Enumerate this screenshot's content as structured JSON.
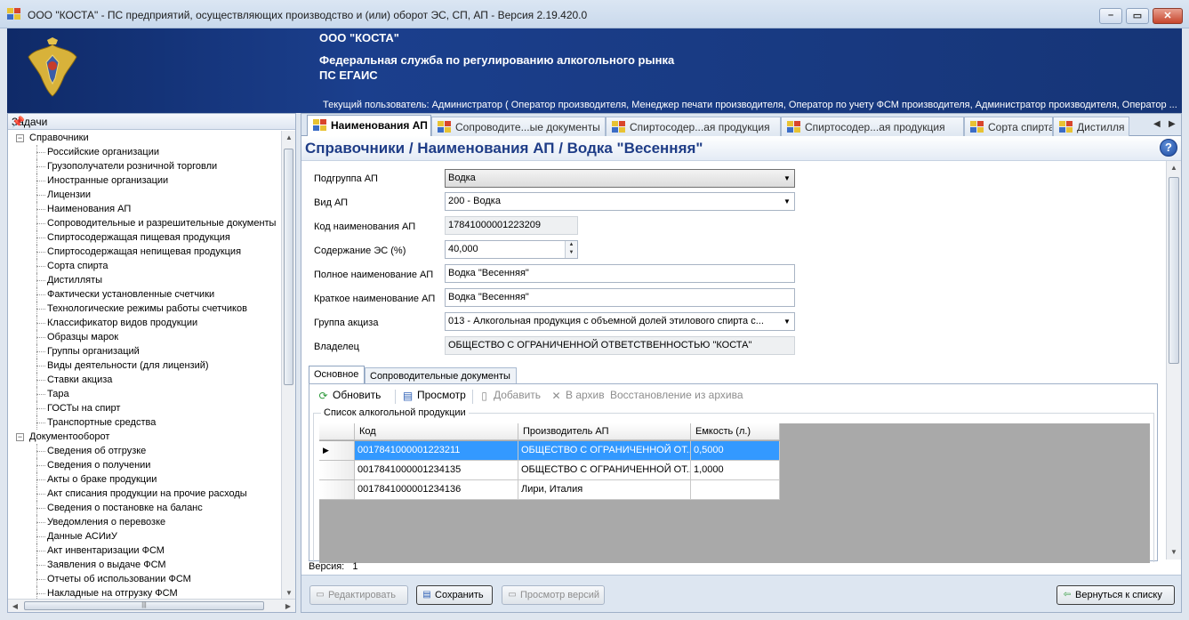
{
  "window": {
    "title": "ООО \"КОСТА\" - ПС предприятий, осуществляющих производство и (или) оборот ЭС, СП, АП - Версия 2.19.420.0"
  },
  "banner": {
    "org": "ООО \"КОСТА\"",
    "agency": "Федеральная служба по регулированию алкогольного рынка",
    "system": "ПС ЕГАИС",
    "current_user": "Текущий пользователь: Администратор ( Оператор производителя, Менеджер печати производителя, Оператор по учету ФСМ производителя, Администратор производителя, Оператор ..."
  },
  "tasks": {
    "header": "Задачи",
    "groups": [
      {
        "label": "Справочники",
        "items": [
          "Российские организации",
          "Грузополучатели розничной торговли",
          "Иностранные организации",
          "Лицензии",
          "Наименования АП",
          "Сопроводительные и разрешительные документы",
          "Спиртосодержащая пищевая продукция",
          "Спиртосодержащая непищевая продукция",
          "Сорта спирта",
          "Дистилляты",
          "Фактически установленные счетчики",
          "Технологические режимы работы счетчиков",
          "Классификатор видов продукции",
          "Образцы марок",
          "Группы организаций",
          "Виды деятельности (для лицензий)",
          "Ставки акциза",
          "Тара",
          "ГОСТы на спирт",
          "Транспортные средства"
        ]
      },
      {
        "label": "Документооборот",
        "items": [
          "Сведения об отгрузке",
          "Сведения о получении",
          "Акты о браке продукции",
          "Акт списания продукции на прочие расходы",
          "Сведения о постановке на баланс",
          "Уведомления о перевозке",
          "Данные АСИиУ",
          "Акт инвентаризации ФСМ",
          "Заявления о выдаче ФСМ",
          "Отчеты об использовании ФСМ",
          "Накладные на отгрузку ФСМ"
        ]
      }
    ]
  },
  "tabs": [
    {
      "label": "Наименования АП",
      "active": true
    },
    {
      "label": "Сопроводите...ые документы",
      "active": false
    },
    {
      "label": "Спиртосодер...ая продукция",
      "active": false
    },
    {
      "label": "Спиртосодер...ая продукция",
      "active": false
    },
    {
      "label": "Сорта спирта",
      "active": false
    },
    {
      "label": "Дистилля",
      "active": false
    }
  ],
  "page": {
    "heading": "Справочники /  Наименования АП / Водка \"Весенняя\"",
    "help": "?"
  },
  "form": {
    "subgroup": {
      "label": "Подгруппа АП",
      "value": "Водка"
    },
    "kind": {
      "label": "Вид АП",
      "value": "200 - Водка"
    },
    "code": {
      "label": "Код наименования АП",
      "value": "17841000001223209"
    },
    "content": {
      "label": "Содержание ЭС (%)",
      "value": "40,000"
    },
    "full_name": {
      "label": "Полное наименование АП",
      "value": "Водка \"Весенняя\""
    },
    "short_name": {
      "label": "Краткое наименование АП",
      "value": "Водка \"Весенняя\""
    },
    "excise_group": {
      "label": "Группа акциза",
      "value": "013 - Алкогольная продукция с объемной долей этилового спирта с..."
    },
    "owner": {
      "label": "Владелец",
      "value": "ОБЩЕСТВО С ОГРАНИЧЕННОЙ ОТВЕТСТВЕННОСТЬЮ \"КОСТА\""
    }
  },
  "inner_tabs": [
    "Основное",
    "Сопроводительные документы"
  ],
  "toolbar": {
    "refresh": "Обновить",
    "view": "Просмотр",
    "add": "Добавить",
    "archive": "В архив",
    "restore": "Восстановление из архива"
  },
  "products": {
    "group_title": "Список алкогольной продукции",
    "columns": [
      "Код",
      "Производитель АП",
      "Емкость (л.)"
    ],
    "rows": [
      {
        "code": "0017841000001223211",
        "producer": "ОБЩЕСТВО С ОГРАНИЧЕННОЙ ОТ...",
        "capacity": "0,5000",
        "selected": true
      },
      {
        "code": "0017841000001234135",
        "producer": "ОБЩЕСТВО С ОГРАНИЧЕННОЙ ОТ...",
        "capacity": "1,0000",
        "selected": false
      },
      {
        "code": "0017841000001234136",
        "producer": "Лири, Италия",
        "capacity": "",
        "selected": false
      }
    ]
  },
  "version": {
    "label": "Версия:",
    "value": "1"
  },
  "buttons": {
    "edit": "Редактировать",
    "save": "Сохранить",
    "versions": "Просмотр версий",
    "back": "Вернуться к списку"
  },
  "colors": {
    "banner": "#1b3f8d",
    "heading_text": "#1f3d87",
    "selection": "#3399ff"
  }
}
